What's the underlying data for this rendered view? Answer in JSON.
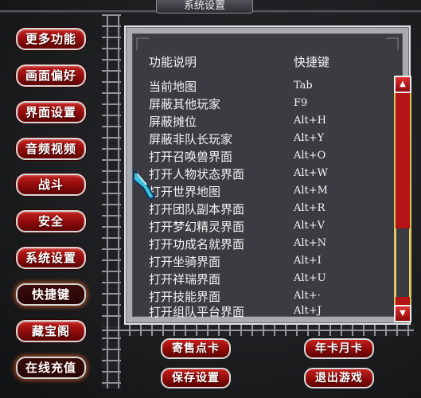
{
  "window": {
    "title": "系统设置"
  },
  "menu": {
    "items": [
      {
        "label": "更多功能"
      },
      {
        "label": "画面偏好"
      },
      {
        "label": "界面设置"
      },
      {
        "label": "音频视频"
      },
      {
        "label": "战斗"
      },
      {
        "label": "安全"
      },
      {
        "label": "系统设置"
      },
      {
        "label": "快捷键"
      },
      {
        "label": "藏宝阁"
      },
      {
        "label": "在线充值"
      }
    ]
  },
  "hotkeys": {
    "header_function": "功能说明",
    "header_key": "快捷键",
    "rows": [
      {
        "name": "当前地图",
        "key": "Tab"
      },
      {
        "name": "屏蔽其他玩家",
        "key": "F9"
      },
      {
        "name": "屏蔽摊位",
        "key": "Alt+H"
      },
      {
        "name": "屏蔽非队长玩家",
        "key": "Alt+Y"
      },
      {
        "name": "打开召唤兽界面",
        "key": "Alt+O"
      },
      {
        "name": "打开人物状态界面",
        "key": "Alt+W"
      },
      {
        "name": "打开世界地图",
        "key": "Alt+M"
      },
      {
        "name": "打开团队副本界面",
        "key": "Alt+R"
      },
      {
        "name": "打开梦幻精灵界面",
        "key": "Alt+V"
      },
      {
        "name": "打开功成名就界面",
        "key": "Alt+N"
      },
      {
        "name": "打开坐骑界面",
        "key": "Alt+I"
      },
      {
        "name": "打开祥瑞界面",
        "key": "Alt+U"
      },
      {
        "name": "打开技能界面",
        "key": "Alt+·"
      },
      {
        "name": "打开组队平台界面",
        "key": "Alt+J"
      }
    ]
  },
  "bottom": {
    "consign": "寄售点卡",
    "monthly_card": "年卡月卡",
    "save": "保存设置",
    "exit": "退出游戏"
  },
  "colors": {
    "button_red": "#a01010",
    "panel_bg": "#3a3c41",
    "scroll_gold": "#d9c35c"
  }
}
